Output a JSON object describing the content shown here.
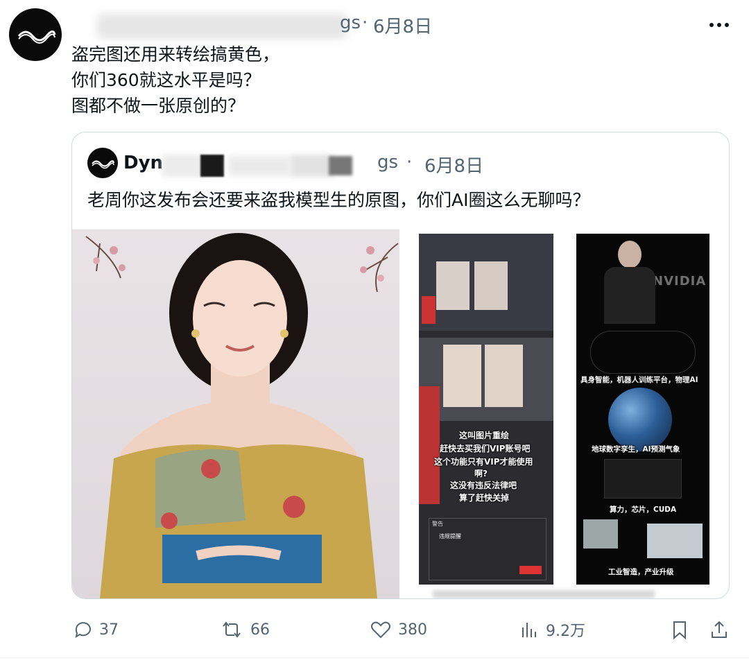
{
  "tweet": {
    "time": "6月8日",
    "handle_suffix": "gs",
    "lines": "盗完图还用来转绘搞黄色，\n你们360就这水平是吗？\n图都不做一张原创的？"
  },
  "quote": {
    "name_prefix": "Dyn",
    "handle_suffix": "gs",
    "time": "6月8日",
    "text": "老周你这发布会还要来盗我模型生的原图，你们AI圈这么无聊吗？",
    "image2": {
      "captions": [
        "这叫图片重绘",
        "赶快去买我们VIP账号吧",
        "这个功能只有VIP才能使用",
        "啊?",
        "这没有违反法律吧",
        "算了赶快关掉"
      ],
      "dialog_title": "警告",
      "dialog_heading": "违规提醒"
    },
    "image3": {
      "brand": "NVIDIA",
      "captions": [
        "具身智能，机器人训练平台，物理AI",
        "地球数字孪生，AI预测气象",
        "算力，芯片，CUDA",
        "工业智造，产业升级"
      ]
    }
  },
  "actions": {
    "reply_count": "37",
    "retweet_count": "66",
    "like_count": "380",
    "views_count": "9.2万"
  },
  "colors": {
    "text": "#0f1419",
    "muted": "#536471",
    "border": "#cfd9de"
  }
}
